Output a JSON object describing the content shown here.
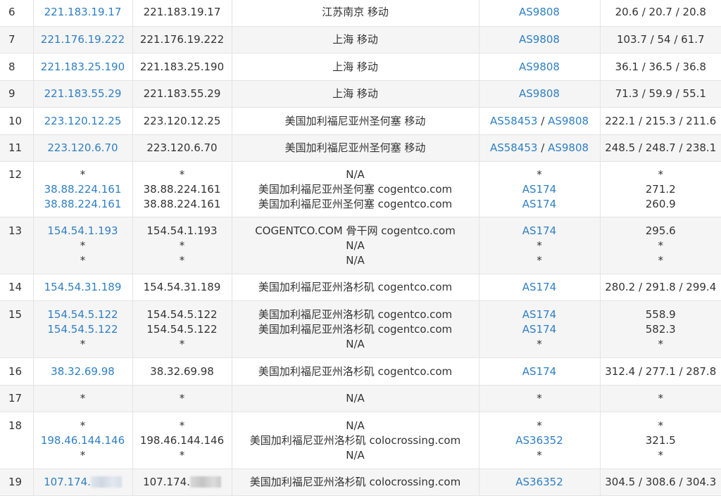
{
  "rows": [
    {
      "hop": "6",
      "ip": [
        "221.183.19.17"
      ],
      "host": [
        "221.183.19.17"
      ],
      "location": [
        "江苏南京 移动"
      ],
      "asn": [
        [
          "AS9808"
        ]
      ],
      "time": [
        "20.6 / 20.7 / 20.8"
      ]
    },
    {
      "hop": "7",
      "ip": [
        "221.176.19.222"
      ],
      "host": [
        "221.176.19.222"
      ],
      "location": [
        "上海 移动"
      ],
      "asn": [
        [
          "AS9808"
        ]
      ],
      "time": [
        "103.7 / 54 / 61.7"
      ]
    },
    {
      "hop": "8",
      "ip": [
        "221.183.25.190"
      ],
      "host": [
        "221.183.25.190"
      ],
      "location": [
        "上海 移动"
      ],
      "asn": [
        [
          "AS9808"
        ]
      ],
      "time": [
        "36.1 / 36.5 / 36.8"
      ]
    },
    {
      "hop": "9",
      "ip": [
        "221.183.55.29"
      ],
      "host": [
        "221.183.55.29"
      ],
      "location": [
        "上海 移动"
      ],
      "asn": [
        [
          "AS9808"
        ]
      ],
      "time": [
        "71.3 / 59.9 / 55.1"
      ]
    },
    {
      "hop": "10",
      "ip": [
        "223.120.12.25"
      ],
      "host": [
        "223.120.12.25"
      ],
      "location": [
        "美国加利福尼亚州圣何塞 移动"
      ],
      "asn": [
        [
          "AS58453",
          "AS9808"
        ]
      ],
      "time": [
        "222.1 / 215.3 / 211.6"
      ]
    },
    {
      "hop": "11",
      "ip": [
        "223.120.6.70"
      ],
      "host": [
        "223.120.6.70"
      ],
      "location": [
        "美国加利福尼亚州圣何塞 移动"
      ],
      "asn": [
        [
          "AS58453",
          "AS9808"
        ]
      ],
      "time": [
        "248.5 / 248.7 / 238.1"
      ]
    },
    {
      "hop": "12",
      "ip": [
        "*",
        "38.88.224.161",
        "38.88.224.161"
      ],
      "host": [
        "*",
        "38.88.224.161",
        "38.88.224.161"
      ],
      "location": [
        "N/A",
        "美国加利福尼亚州圣何塞 cogentco.com",
        "美国加利福尼亚州圣何塞 cogentco.com"
      ],
      "asn": [
        [
          "*"
        ],
        [
          "AS174"
        ],
        [
          "AS174"
        ]
      ],
      "time": [
        "*",
        "271.2",
        "260.9"
      ]
    },
    {
      "hop": "13",
      "ip": [
        "154.54.1.193",
        "*",
        "*"
      ],
      "host": [
        "154.54.1.193",
        "*",
        "*"
      ],
      "location": [
        "COGENTCO.COM 骨干网 cogentco.com",
        "N/A",
        "N/A"
      ],
      "asn": [
        [
          "AS174"
        ],
        [
          "*"
        ],
        [
          "*"
        ]
      ],
      "time": [
        "295.6",
        "*",
        "*"
      ]
    },
    {
      "hop": "14",
      "ip": [
        "154.54.31.189"
      ],
      "host": [
        "154.54.31.189"
      ],
      "location": [
        "美国加利福尼亚州洛杉矶 cogentco.com"
      ],
      "asn": [
        [
          "AS174"
        ]
      ],
      "time": [
        "280.2 / 291.8 / 299.4"
      ]
    },
    {
      "hop": "15",
      "ip": [
        "154.54.5.122",
        "154.54.5.122",
        "*"
      ],
      "host": [
        "154.54.5.122",
        "154.54.5.122",
        "*"
      ],
      "location": [
        "美国加利福尼亚州洛杉矶 cogentco.com",
        "美国加利福尼亚州洛杉矶 cogentco.com",
        "N/A"
      ],
      "asn": [
        [
          "AS174"
        ],
        [
          "AS174"
        ],
        [
          "*"
        ]
      ],
      "time": [
        "558.9",
        "582.3",
        "*"
      ]
    },
    {
      "hop": "16",
      "ip": [
        "38.32.69.98"
      ],
      "host": [
        "38.32.69.98"
      ],
      "location": [
        "美国加利福尼亚州洛杉矶 cogentco.com"
      ],
      "asn": [
        [
          "AS174"
        ]
      ],
      "time": [
        "312.4 / 277.1 / 287.8"
      ]
    },
    {
      "hop": "17",
      "ip": [
        "*"
      ],
      "host": [
        "*"
      ],
      "location": [
        "N/A"
      ],
      "asn": [
        [
          "*"
        ]
      ],
      "time": [
        "*"
      ]
    },
    {
      "hop": "18",
      "ip": [
        "*",
        "198.46.144.146",
        "*"
      ],
      "host": [
        "*",
        "198.46.144.146",
        "*"
      ],
      "location": [
        "N/A",
        "美国加利福尼亚州洛杉矶 colocrossing.com",
        "N/A"
      ],
      "asn": [
        [
          "*"
        ],
        [
          "AS36352"
        ],
        [
          "*"
        ]
      ],
      "time": [
        "*",
        "321.5",
        "*"
      ]
    },
    {
      "hop": "19",
      "ip": [
        "107.174."
      ],
      "host": [
        "107.174."
      ],
      "location": [
        "美国加利福尼亚州洛杉矶 colocrossing.com"
      ],
      "asn": [
        [
          "AS36352"
        ]
      ],
      "time": [
        "304.5 / 308.6 / 304.3"
      ],
      "redacted": true
    }
  ],
  "as_separator": "/",
  "colors": {
    "link": "#2f7fc3",
    "text": "#333333",
    "row_alt": "#f5f5f5",
    "border": "#e4e4e4"
  }
}
